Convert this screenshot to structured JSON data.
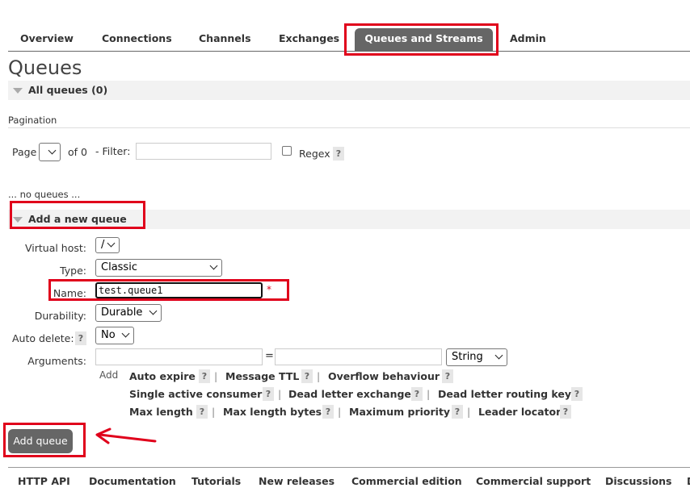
{
  "tabs": [
    {
      "label": "Overview"
    },
    {
      "label": "Connections"
    },
    {
      "label": "Channels"
    },
    {
      "label": "Exchanges"
    },
    {
      "label": "Queues and Streams"
    },
    {
      "label": "Admin"
    }
  ],
  "active_tab": "Queues and Streams",
  "page_title": "Queues",
  "all_queues": {
    "label": "All queues (0)"
  },
  "pagination": {
    "heading": "Pagination",
    "page_label": "Page",
    "of_label": "of 0",
    "filter_label": "- Filter:",
    "filter_value": "",
    "regex_label": "Regex",
    "help": "?"
  },
  "no_queues_text": "... no queues ...",
  "add_queue_section": {
    "label": "Add a new queue"
  },
  "form": {
    "virtual_host_label": "Virtual host:",
    "virtual_host_value": "/",
    "type_label": "Type:",
    "type_value": "Classic",
    "name_label": "Name:",
    "name_value": "test.queue1",
    "required_mark": "*",
    "durability_label": "Durability:",
    "durability_value": "Durable",
    "auto_delete_label": "Auto delete:",
    "auto_delete_value": "No",
    "arguments_label": "Arguments:",
    "equals": "=",
    "arg_type_value": "String",
    "add_label": "Add"
  },
  "argument_links": {
    "row1": [
      "Auto expire",
      "Message TTL",
      "Overflow behaviour"
    ],
    "row2": [
      "Single active consumer",
      "Dead letter exchange",
      "Dead letter routing key"
    ],
    "row3": [
      "Max length",
      "Max length bytes",
      "Maximum priority",
      "Leader locator"
    ],
    "help": "?",
    "separator": "|"
  },
  "add_queue_button": "Add queue",
  "footer": [
    "HTTP API",
    "Documentation",
    "Tutorials",
    "New releases",
    "Commercial edition",
    "Commercial support",
    "Discussions",
    "D"
  ],
  "colors": {
    "annotation_red": "#e0001b",
    "tab_active_bg": "#666666",
    "section_bg": "#f2f2f2"
  }
}
